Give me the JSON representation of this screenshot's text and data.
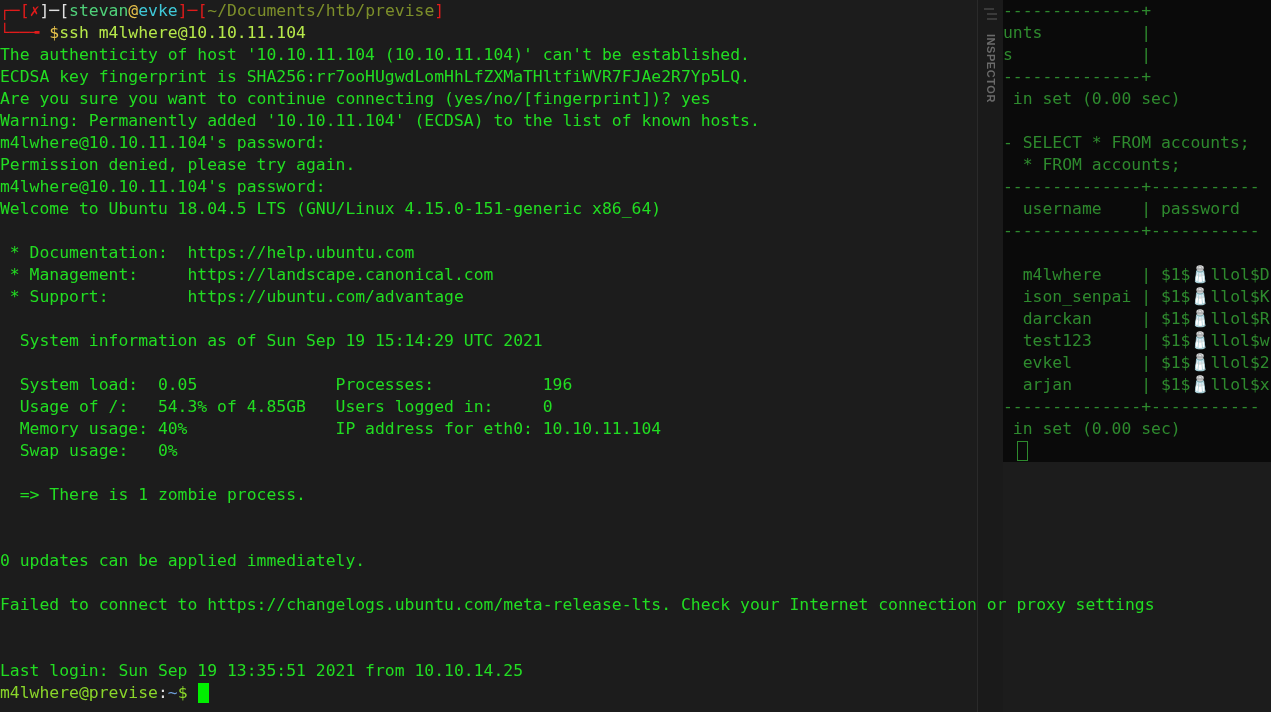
{
  "terminal": {
    "prompt_lines": [
      {
        "segments": [
          {
            "text": "┌─",
            "color": "#e01b1b"
          },
          {
            "text": "[",
            "color": "#e01b1b"
          },
          {
            "text": "✗",
            "color": "#e01b1b"
          },
          {
            "text": "]─[",
            "color": "#e0e0e0"
          },
          {
            "text": "stevan",
            "color": "#4fd17a"
          },
          {
            "text": "@",
            "color": "#e5c04a"
          },
          {
            "text": "evke",
            "color": "#3fc9d8"
          },
          {
            "text": "]─[",
            "color": "#e01b1b"
          },
          {
            "text": "~/Documents/htb/previse",
            "color": "#7d8f2a"
          },
          {
            "text": "]",
            "color": "#e01b1b"
          }
        ]
      },
      {
        "segments": [
          {
            "text": "└──╼ ",
            "color": "#e01b1b"
          },
          {
            "text": "$",
            "color": "#e5c04a"
          },
          {
            "text": "ssh m4lwhere@10.10.11.104",
            "color": "#b6e84a"
          }
        ]
      }
    ],
    "lines": [
      {
        "kind": "text",
        "text": "The authenticity of host '10.10.11.104 (10.10.11.104)' can't be established."
      },
      {
        "kind": "text",
        "text": "ECDSA key fingerprint is SHA256:rr7ooHUgwdLomHhLfZXMaTHltfiWVR7FJAe2R7Yp5LQ."
      },
      {
        "kind": "text",
        "text": "Are you sure you want to continue connecting (yes/no/[fingerprint])? yes"
      },
      {
        "kind": "text",
        "text": "Warning: Permanently added '10.10.11.104' (ECDSA) to the list of known hosts."
      },
      {
        "kind": "text",
        "text": "m4lwhere@10.10.11.104's password:"
      },
      {
        "kind": "text",
        "text": "Permission denied, please try again."
      },
      {
        "kind": "text",
        "text": "m4lwhere@10.10.11.104's password:"
      },
      {
        "kind": "text",
        "text": "Welcome to Ubuntu 18.04.5 LTS (GNU/Linux 4.15.0-151-generic x86_64)"
      },
      {
        "kind": "blank"
      },
      {
        "kind": "text",
        "text": " * Documentation:  https://help.ubuntu.com"
      },
      {
        "kind": "text",
        "text": " * Management:     https://landscape.canonical.com"
      },
      {
        "kind": "text",
        "text": " * Support:        https://ubuntu.com/advantage"
      },
      {
        "kind": "blank"
      },
      {
        "kind": "text",
        "text": "  System information as of Sun Sep 19 15:14:29 UTC 2021"
      },
      {
        "kind": "blank"
      },
      {
        "kind": "text",
        "text": "  System load:  0.05              Processes:           196"
      },
      {
        "kind": "text",
        "text": "  Usage of /:   54.3% of 4.85GB   Users logged in:     0"
      },
      {
        "kind": "text",
        "text": "  Memory usage: 40%               IP address for eth0: 10.10.11.104"
      },
      {
        "kind": "text",
        "text": "  Swap usage:   0%"
      },
      {
        "kind": "blank"
      },
      {
        "kind": "text",
        "text": "  => There is 1 zombie process."
      },
      {
        "kind": "blank"
      },
      {
        "kind": "blank"
      },
      {
        "kind": "text",
        "text": "0 updates can be applied immediately."
      },
      {
        "kind": "blank"
      },
      {
        "kind": "text",
        "text": "Failed to connect to https://changelogs.ubuntu.com/meta-release-lts. Check your Internet connection or proxy settings"
      },
      {
        "kind": "blank"
      },
      {
        "kind": "blank"
      },
      {
        "kind": "text",
        "text": "Last login: Sun Sep 19 13:35:51 2021 from 10.10.14.25"
      }
    ],
    "final_prompt": {
      "segments": [
        {
          "text": "m4lwhere@previse",
          "color": "#8ad62a"
        },
        {
          "text": ":",
          "color": "#e0e0e0"
        },
        {
          "text": "~",
          "color": "#6f9fd8"
        },
        {
          "text": "$",
          "color": "#8ad62a"
        }
      ]
    }
  },
  "inspector": {
    "label": "INSPECTOR"
  },
  "background_terminal": {
    "lines": [
      {
        "kind": "text",
        "text": "--------------+"
      },
      {
        "kind": "text",
        "text": "unts          |"
      },
      {
        "kind": "text",
        "text": "s             |"
      },
      {
        "kind": "text",
        "text": "--------------+"
      },
      {
        "kind": "text",
        "text": " in set (0.00 sec)"
      },
      {
        "kind": "blank"
      },
      {
        "kind": "text",
        "text": "- SELECT * FROM accounts;"
      },
      {
        "kind": "text",
        "text": "  * FROM accounts;"
      },
      {
        "kind": "text",
        "text": "--------------+-----------"
      },
      {
        "kind": "text",
        "text": "  username    | password"
      },
      {
        "kind": "text",
        "text": "--------------+-----------"
      },
      {
        "kind": "blank"
      },
      {
        "kind": "text",
        "text": "  m4lwhere    | $1$🧂llol$D"
      },
      {
        "kind": "text",
        "text": "  ison_senpai | $1$🧂llol$K"
      },
      {
        "kind": "text",
        "text": "  darckan     | $1$🧂llol$R"
      },
      {
        "kind": "text",
        "text": "  test123     | $1$🧂llol$w"
      },
      {
        "kind": "text",
        "text": "  evkel       | $1$🧂llol$2"
      },
      {
        "kind": "text",
        "text": "  arjan       | $1$🧂llol$x"
      },
      {
        "kind": "text",
        "text": "--------------+-----------"
      },
      {
        "kind": "text",
        "text": " in set (0.00 sec)"
      }
    ]
  }
}
